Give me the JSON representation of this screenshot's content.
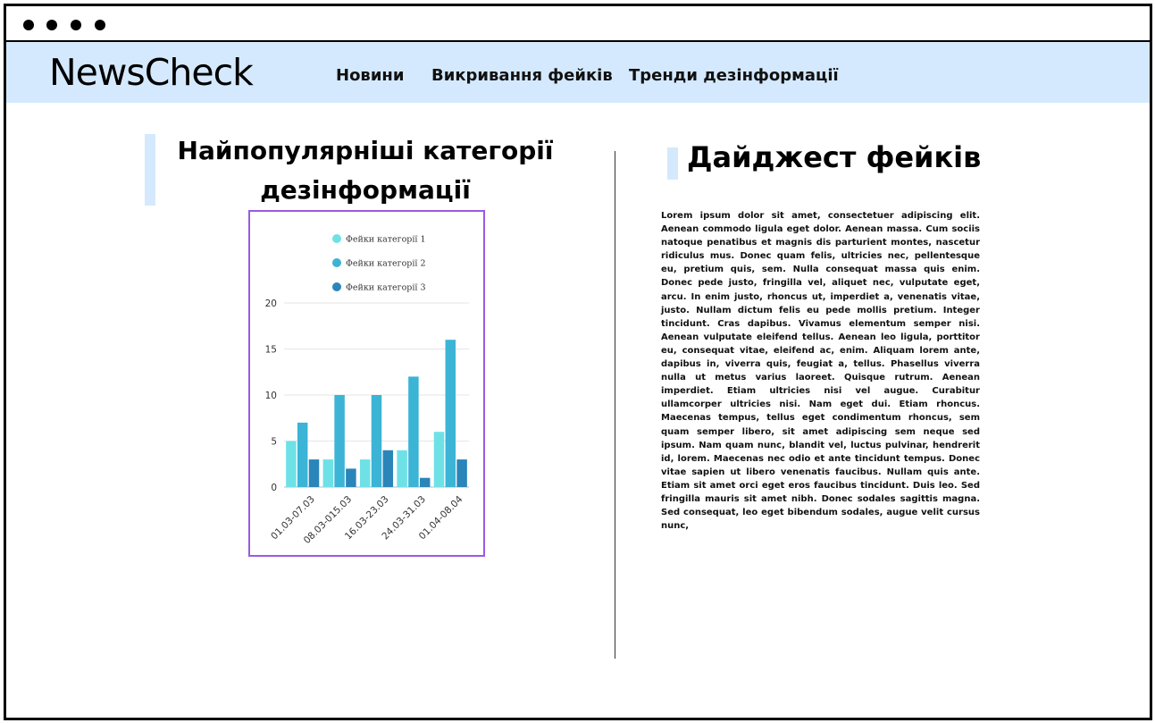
{
  "browser": {
    "window_dots": 4
  },
  "navbar": {
    "logo": "NewsCheck",
    "links": [
      "Новини",
      "Викривання фейків",
      "Тренди дезінформації"
    ],
    "background": "#d4e9fd"
  },
  "left_section": {
    "title_line1": "Найпопулярніші категорії",
    "title_line2": "дезінформації"
  },
  "right_section": {
    "title": "Дайджест фейків",
    "text": "Lorem ipsum dolor sit amet, consectetuer adipiscing elit. Aenean commodo ligula eget dolor. Aenean massa. Cum sociis natoque penatibus et magnis dis parturient montes, nascetur ridiculus mus. Donec quam felis, ultricies nec, pellentesque eu, pretium quis, sem. Nulla consequat massa quis enim. Donec pede justo, fringilla vel, aliquet nec, vulputate eget, arcu. In enim justo, rhoncus ut, imperdiet a, venenatis vitae, justo. Nullam dictum felis eu pede mollis pretium. Integer tincidunt. Cras dapibus. Vivamus elementum semper nisi. Aenean vulputate eleifend tellus. Aenean leo ligula, porttitor eu, consequat vitae, eleifend ac, enim. Aliquam lorem ante, dapibus in, viverra quis, feugiat a, tellus. Phasellus viverra nulla ut metus varius laoreet. Quisque rutrum. Aenean imperdiet. Etiam ultricies nisi vel augue. Curabitur ullamcorper ultricies nisi. Nam eget dui. Etiam rhoncus. Maecenas tempus, tellus eget condimentum rhoncus, sem quam semper libero, sit amet adipiscing sem neque sed ipsum. Nam quam nunc, blandit vel, luctus pulvinar, hendrerit id, lorem. Maecenas nec odio et ante tincidunt tempus. Donec vitae sapien ut libero venenatis faucibus. Nullam quis ante. Etiam sit amet orci eget eros faucibus tincidunt. Duis leo. Sed fringilla mauris sit amet nibh. Donec sodales sagittis magna. Sed consequat, leo eget bibendum sodales, augue velit cursus nunc,"
  },
  "chart_data": {
    "type": "bar",
    "categories": [
      "01.03-07.03",
      "08.03-015.03",
      "16.03-23.03",
      "24.03-31.03",
      "01.04-08.04"
    ],
    "series": [
      {
        "name": "Фейки категорії 1",
        "values": [
          5,
          3,
          3,
          4,
          6
        ],
        "color": "#6ee1e6"
      },
      {
        "name": "Фейки категорії 2",
        "values": [
          7,
          10,
          10,
          12,
          16
        ],
        "color": "#3bb4d6"
      },
      {
        "name": "Фейки категорії 3",
        "values": [
          3,
          2,
          4,
          1,
          3
        ],
        "color": "#2a85b9"
      }
    ],
    "yticks": [
      "0",
      "5",
      "10",
      "15",
      "20"
    ],
    "ylim": [
      0,
      20
    ],
    "grid": true,
    "legend": "top",
    "frame_color": "#9b59e3"
  }
}
